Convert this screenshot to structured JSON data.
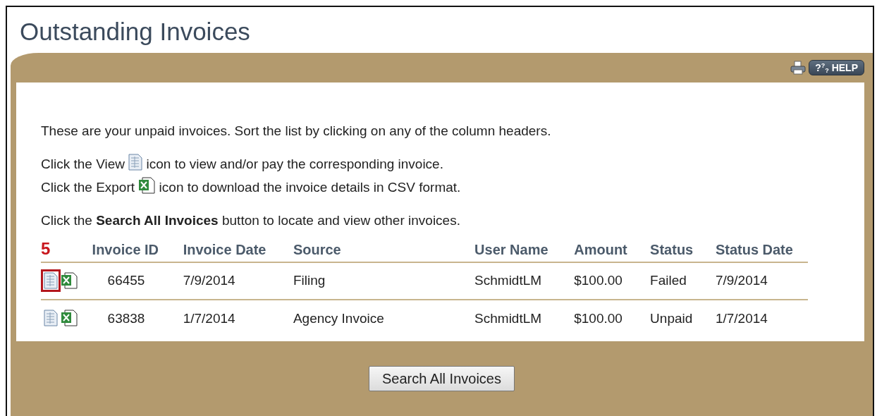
{
  "title": "Outstanding Invoices",
  "help": {
    "label": "?$^{?}$$_{?}$ HELP"
  },
  "intro": [
    {
      "kind": "plain",
      "text": "These are your unpaid invoices. Sort the list by clicking on any of the column headers."
    },
    {
      "kind": "view",
      "before": "Click the View",
      "after": "icon to view and/or pay the corresponding invoice."
    },
    {
      "kind": "export",
      "before": "Click the Export",
      "after": "icon to download the invoice details in CSV format."
    },
    {
      "kind": "plain",
      "text": "Click the **Search All Invoices** button to locate and view other invoices."
    }
  ],
  "callout": "5",
  "table": {
    "columns": [
      "Invoice ID",
      "Invoice Date",
      "Source",
      "User Name",
      "Amount",
      "Status",
      "Status Date"
    ],
    "rows": [
      {
        "highlighted": true,
        "cells": [
          "66455",
          "7/9/2014",
          "Filing",
          "SchmidtLM",
          "$100.00",
          "Failed",
          "7/9/2014"
        ]
      },
      {
        "highlighted": false,
        "cells": [
          "63838",
          "1/7/2014",
          "Agency Invoice",
          "SchmidtLM",
          "$100.00",
          "Unpaid",
          "1/7/2014"
        ]
      }
    ]
  },
  "button": "Search All Invoices"
}
